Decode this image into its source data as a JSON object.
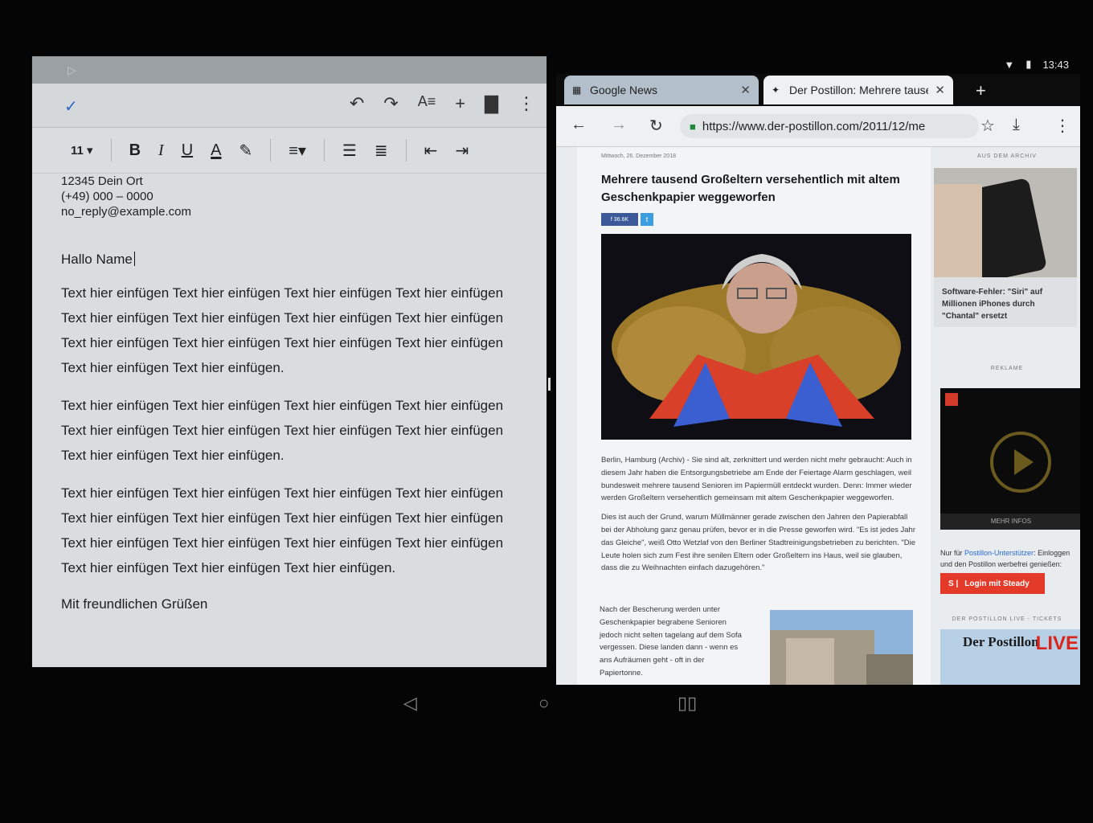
{
  "status": {
    "time": "13:43",
    "wifi_icon": "wifi-icon",
    "battery_icon": "battery-icon"
  },
  "docs": {
    "toolbar": {
      "check_icon": "check-icon",
      "tools": [
        "undo-icon",
        "redo-icon",
        "text-format-icon",
        "insert-icon",
        "comment-icon",
        "more-vert-icon"
      ]
    },
    "format_bar": {
      "font_size": "11",
      "buttons": [
        "bold",
        "italic",
        "underline",
        "text-color",
        "highlight",
        "align",
        "bullet-list",
        "numbered-list",
        "outdent",
        "indent"
      ]
    },
    "address": [
      "12345 Dein Ort",
      "(+49) 000 – 0000",
      "no_reply@example.com"
    ],
    "greeting": "Hallo Name",
    "paragraphs": [
      "Text hier einfügen Text hier einfügen Text hier einfügen Text hier einfügen Text hier einfügen Text hier einfügen Text hier einfügen Text hier einfügen Text hier einfügen Text hier einfügen Text hier einfügen Text hier einfügen Text hier einfügen Text hier einfügen.",
      "Text hier einfügen Text hier einfügen Text hier einfügen Text hier einfügen Text hier einfügen Text hier einfügen Text hier einfügen Text hier einfügen Text hier einfügen Text hier einfügen.",
      "Text hier einfügen Text hier einfügen Text hier einfügen Text hier einfügen Text hier einfügen Text hier einfügen Text hier einfügen Text hier einfügen Text hier einfügen Text hier einfügen Text hier einfügen Text hier einfügen Text hier einfügen Text hier einfügen Text hier einfügen."
    ],
    "closing": "Mit freundlichen Grüßen"
  },
  "browser": {
    "tabs": [
      {
        "label": "Google News",
        "active": false
      },
      {
        "label": "Der Postillon: Mehrere tause",
        "active": true
      }
    ],
    "url": "https://www.der-postillon.com/2011/12/me",
    "article": {
      "date": "Mittwoch, 26. Dezember 2018",
      "headline": "Mehrere tausend Großeltern versehentlich mit altem Geschenkpapier weggeworfen",
      "fb_count": "36.6K",
      "paragraphs": [
        "Berlin, Hamburg (Archiv) - Sie sind alt, zerknittert und werden nicht mehr gebraucht: Auch in diesem Jahr haben die Entsorgungsbetriebe am Ende der Feiertage Alarm geschlagen, weil bundesweit mehrere tausend Senioren im Papiermüll entdeckt wurden. Denn: Immer wieder werden Großeltern versehentlich gemeinsam mit altem Geschenkpapier weggeworfen.",
        "Dies ist auch der Grund, warum Müllmänner gerade zwischen den Jahren den Papierabfall bei der Abholung ganz genau prüfen, bevor er in die Presse geworfen wird. \"Es ist jedes Jahr das Gleiche\", weiß Otto Wetzlaf von den Berliner Stadtreinigungsbetrieben zu berichten. \"Die Leute holen sich zum Fest ihre senilen Eltern oder Großeltern ins Haus, weil sie glauben, dass die zu Weihnachten einfach dazugehören.\""
      ],
      "paragraph3": "Nach der Bescherung werden unter Geschenkpapier begrabene Senioren jedoch nicht selten tagelang auf dem Sofa vergessen. Diese landen dann - wenn es ans Aufräumen geht - oft in der Papiertonne."
    },
    "sidebar": {
      "archive_header": "AUS DEM ARCHIV",
      "archive_caption": "Software-Fehler: \"Siri\" auf Millionen iPhones durch \"Chantal\" ersetzt",
      "ad_header": "REKLAME",
      "video_more": "MEHR INFOS",
      "steady_text_a": "Nur für ",
      "steady_link": "Postillon-Unterstützer",
      "steady_text_b": ": Einloggen und den Postillon werbefrei genießen:",
      "steady_button": "Login mit Steady",
      "live_header": "DER POSTILLON LIVE - TICKETS",
      "live_title": "Der Postillon",
      "live_word": "LIVE"
    }
  },
  "navbar": [
    "back-icon",
    "home-icon",
    "recents-icon"
  ]
}
